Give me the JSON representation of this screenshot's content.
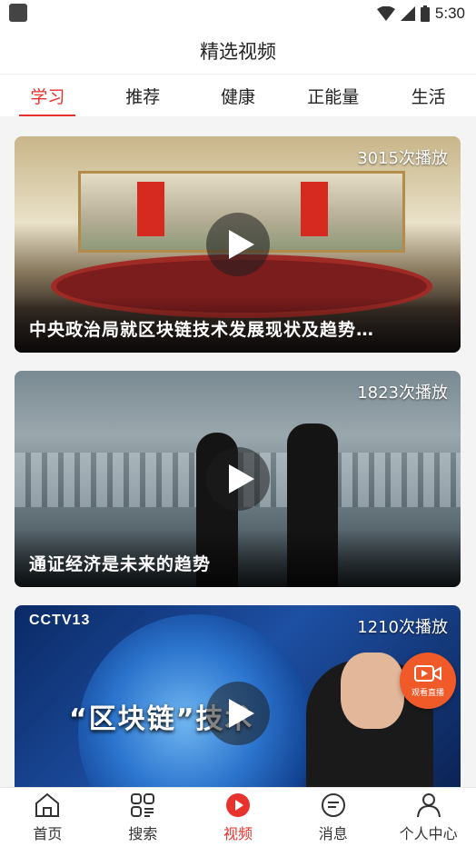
{
  "status_bar": {
    "time": "5:30"
  },
  "header": {
    "title": "精选视频"
  },
  "tabs": [
    {
      "label": "学习",
      "active": true
    },
    {
      "label": "推荐",
      "active": false
    },
    {
      "label": "健康",
      "active": false
    },
    {
      "label": "正能量",
      "active": false
    },
    {
      "label": "生活",
      "active": false
    }
  ],
  "videos": [
    {
      "views": "3015次播放",
      "title": "中央政治局就区块链技术发展现状及趋势…"
    },
    {
      "views": "1823次播放",
      "title": "通证经济是未来的趋势"
    },
    {
      "views": "1210次播放",
      "title": "",
      "channel_logo": "CCTV13",
      "banner": "“区块链”技术"
    }
  ],
  "live_float": {
    "label": "观看直播"
  },
  "bottom_nav": [
    {
      "label": "首页",
      "icon": "home-icon",
      "active": false
    },
    {
      "label": "搜索",
      "icon": "search-icon",
      "active": false
    },
    {
      "label": "视频",
      "icon": "video-play-icon",
      "active": true
    },
    {
      "label": "消息",
      "icon": "message-icon",
      "active": false
    },
    {
      "label": "个人中心",
      "icon": "person-icon",
      "active": false
    }
  ],
  "colors": {
    "accent": "#e8322e",
    "live_button": "#f05a28"
  }
}
